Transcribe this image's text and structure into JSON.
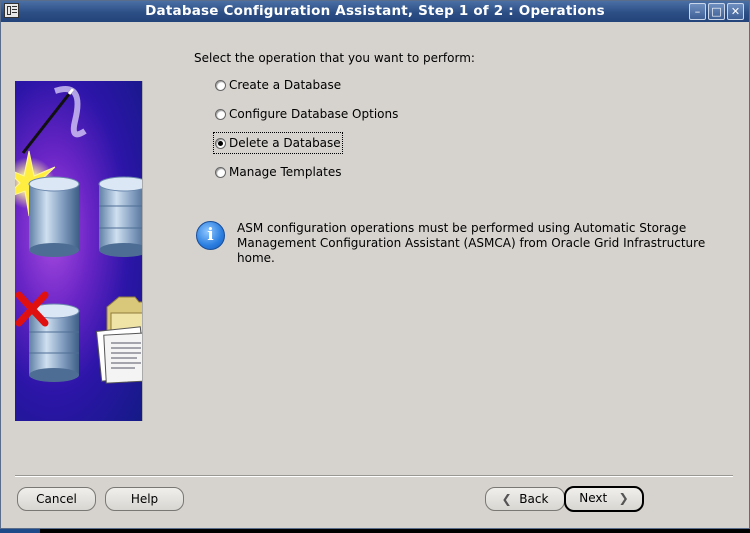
{
  "window": {
    "title": "Database Configuration Assistant, Step 1 of 2 : Operations",
    "minimize_icon": "minimize-icon",
    "maximize_icon": "maximize-icon",
    "close_icon": "close-icon"
  },
  "main": {
    "prompt": "Select the operation that you want to perform:",
    "options": [
      {
        "label": "Create a Database",
        "checked": false
      },
      {
        "label": "Configure Database Options",
        "checked": false
      },
      {
        "label": "Delete a Database",
        "checked": true
      },
      {
        "label": "Manage Templates",
        "checked": false
      }
    ],
    "info_message_line1": "ASM configuration operations must be performed using Automatic Storage",
    "info_message_line2": "Management Configuration Assistant (ASMCA) from Oracle Grid Infrastructure home."
  },
  "buttons": {
    "cancel": "Cancel",
    "help": "Help",
    "back": "Back",
    "next": "Next"
  },
  "colors": {
    "titlebar": "#2c4f86",
    "dialog_bg": "#d6d3ce",
    "info_blue": "#2a7ee0"
  }
}
